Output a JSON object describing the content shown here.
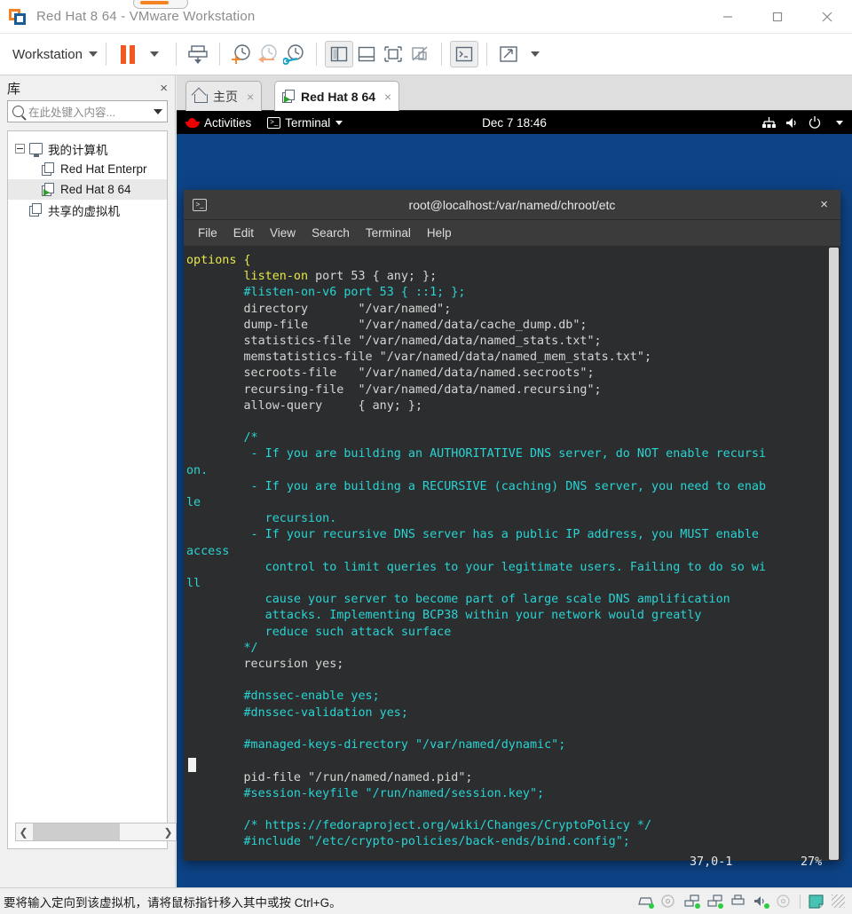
{
  "window": {
    "title": "Red Hat  8 64  - VMware Workstation",
    "minimize_label": "Minimize",
    "maximize_label": "Maximize",
    "close_label": "Close"
  },
  "toolbar": {
    "menu_label": "Workstation",
    "items": [
      {
        "name": "pause",
        "label": "Pause"
      },
      {
        "name": "power-dropdown",
        "label": "Power options"
      },
      {
        "name": "suspend",
        "label": "Suspend guest"
      },
      {
        "name": "take-snapshot",
        "label": "Take snapshot"
      },
      {
        "name": "revert-snapshot",
        "label": "Revert to snapshot"
      },
      {
        "name": "snapshot-manager",
        "label": "Manage snapshots"
      },
      {
        "name": "show-library",
        "label": "Show library"
      },
      {
        "name": "show-thumbnail-bar",
        "label": "Show thumbnail bar"
      },
      {
        "name": "full-screen",
        "label": "Enter full screen"
      },
      {
        "name": "unity-mode",
        "label": "Unity mode"
      },
      {
        "name": "console-view",
        "label": "Console view"
      },
      {
        "name": "stretch-guest",
        "label": "Stretch guest"
      }
    ]
  },
  "library": {
    "title": "库",
    "close_label": "×",
    "search_placeholder": "在此处键入内容...",
    "tree": [
      {
        "label": "我的计算机",
        "icon": "monitor-icon",
        "level": 0,
        "selected": false,
        "expanded": true
      },
      {
        "label": "Red Hat Enterpr",
        "icon": "vm-icon",
        "level": 1,
        "selected": false
      },
      {
        "label": "Red Hat  8 64",
        "icon": "vm-running-icon",
        "level": 1,
        "selected": true
      },
      {
        "label": "共享的虚拟机",
        "icon": "shared-vm-icon",
        "level": 0,
        "selected": false
      }
    ]
  },
  "tabs": [
    {
      "label": "主页",
      "icon": "home-icon",
      "active": false,
      "close_label": "×"
    },
    {
      "label": "Red Hat  8 64",
      "icon": "vm-running-icon",
      "active": true,
      "close_label": "×"
    }
  ],
  "guest": {
    "topbar": {
      "activities_label": "Activities",
      "app_label": "Terminal",
      "clock": "Dec 7 18:46",
      "icons": [
        "network-icon",
        "volume-icon",
        "power-icon",
        "chevron-down-icon"
      ]
    },
    "terminal": {
      "title": "root@localhost:/var/named/chroot/etc",
      "close_label": "×",
      "menu": [
        "File",
        "Edit",
        "View",
        "Search",
        "Terminal",
        "Help"
      ],
      "status_position": "37,0-1",
      "status_percent": "27%",
      "content_lines": [
        [
          {
            "t": "options {",
            "c": "kw-start"
          }
        ],
        [
          {
            "t": "        ",
            "c": "pl"
          },
          {
            "t": "listen-on",
            "c": "kw"
          },
          {
            "t": " port 53 { any; };",
            "c": "pl"
          }
        ],
        [
          {
            "t": "        ",
            "c": "pl"
          },
          {
            "t": "#listen-on-v6 port 53 { ::1; };",
            "c": "cm"
          }
        ],
        [
          {
            "t": "        directory       \"/var/named\";",
            "c": "pl"
          }
        ],
        [
          {
            "t": "        dump-file       \"/var/named/data/cache_dump.db\";",
            "c": "pl"
          }
        ],
        [
          {
            "t": "        statistics-file \"/var/named/data/named_stats.txt\";",
            "c": "pl"
          }
        ],
        [
          {
            "t": "        memstatistics-file \"/var/named/data/named_mem_stats.txt\";",
            "c": "pl"
          }
        ],
        [
          {
            "t": "        secroots-file   \"/var/named/data/named.secroots\";",
            "c": "pl"
          }
        ],
        [
          {
            "t": "        recursing-file  \"/var/named/data/named.recursing\";",
            "c": "pl"
          }
        ],
        [
          {
            "t": "        allow-query     { any; };",
            "c": "pl"
          }
        ],
        [
          {
            "t": "",
            "c": "pl"
          }
        ],
        [
          {
            "t": "        /*",
            "c": "cm"
          }
        ],
        [
          {
            "t": "         - If you are building an AUTHORITATIVE DNS server, do NOT enable recursi",
            "c": "cm"
          }
        ],
        [
          {
            "t": "on.",
            "c": "cm"
          }
        ],
        [
          {
            "t": "         - If you are building a RECURSIVE (caching) DNS server, you need to enab",
            "c": "cm"
          }
        ],
        [
          {
            "t": "le",
            "c": "cm"
          }
        ],
        [
          {
            "t": "           recursion.",
            "c": "cm"
          }
        ],
        [
          {
            "t": "         - If your recursive DNS server has a public IP address, you MUST enable ",
            "c": "cm"
          }
        ],
        [
          {
            "t": "access",
            "c": "cm"
          }
        ],
        [
          {
            "t": "           control to limit queries to your legitimate users. Failing to do so wi",
            "c": "cm"
          }
        ],
        [
          {
            "t": "ll",
            "c": "cm"
          }
        ],
        [
          {
            "t": "           cause your server to become part of large scale DNS amplification",
            "c": "cm"
          }
        ],
        [
          {
            "t": "           attacks. Implementing BCP38 within your network would greatly",
            "c": "cm"
          }
        ],
        [
          {
            "t": "           reduce such attack surface",
            "c": "cm"
          }
        ],
        [
          {
            "t": "        */",
            "c": "cm"
          }
        ],
        [
          {
            "t": "        recursion yes;",
            "c": "pl"
          }
        ],
        [
          {
            "t": "",
            "c": "pl"
          }
        ],
        [
          {
            "t": "        #dnssec-enable yes;",
            "c": "cm"
          }
        ],
        [
          {
            "t": "        #dnssec-validation yes;",
            "c": "cm"
          }
        ],
        [
          {
            "t": "",
            "c": "pl"
          }
        ],
        [
          {
            "t": "        #managed-keys-directory \"/var/named/dynamic\";",
            "c": "cm"
          }
        ],
        [
          {
            "t": "",
            "c": "pl"
          }
        ],
        [
          {
            "t": "        pid-file \"/run/named/named.pid\";",
            "c": "pl"
          }
        ],
        [
          {
            "t": "        #session-keyfile \"/run/named/session.key\";",
            "c": "cm"
          }
        ],
        [
          {
            "t": "",
            "c": "pl"
          }
        ],
        [
          {
            "t": "        /* https://fedoraproject.org/wiki/Changes/CryptoPolicy */",
            "c": "cm"
          }
        ],
        [
          {
            "t": "        #include \"/etc/crypto-policies/back-ends/bind.config\";",
            "c": "cm"
          }
        ]
      ]
    }
  },
  "statusbar": {
    "message": "要将输入定向到该虚拟机，请将鼠标指针移入其中或按 Ctrl+G。",
    "devices": [
      "hard-disk-icon",
      "cd-drive-icon",
      "network-adapter-icon",
      "network-adapter-2-icon",
      "printer-icon",
      "sound-icon",
      "usb-icon",
      "display-icon"
    ]
  },
  "colors": {
    "accent_orange": "#f05a22",
    "desktop_blue": "#0d4488",
    "terminal_bg": "#2b2d2e",
    "comment_cyan": "#2ad4d4",
    "keyword_yellow": "#e8e84a",
    "redhat_red": "#ee0000"
  }
}
